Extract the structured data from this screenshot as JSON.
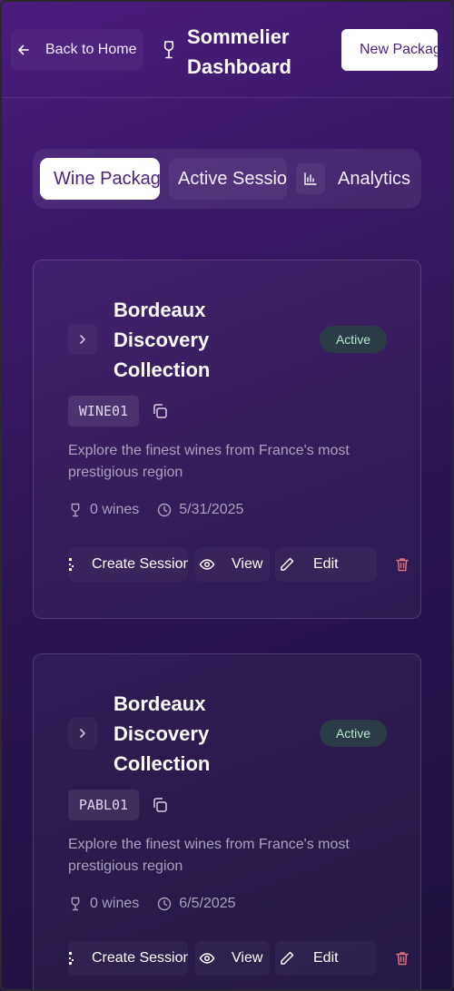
{
  "header": {
    "back_label": "Back to Home",
    "title": "Sommelier Dashboard",
    "new_package_label": "New Package"
  },
  "tabs": [
    {
      "label": "Wine Packages",
      "selected": true
    },
    {
      "label": "Active Sessions",
      "selected": false
    },
    {
      "label": "Analytics",
      "selected": false
    }
  ],
  "packages": [
    {
      "title": "Bordeaux Discovery Collection",
      "status": "Active",
      "code": "WINE01",
      "description": "Explore the finest wines from France's most prestigious region",
      "wines": "0 wines",
      "date": "5/31/2025"
    },
    {
      "title": "Bordeaux Discovery Collection",
      "status": "Active",
      "code": "PABL01",
      "description": "Explore the finest wines from France's most prestigious region",
      "wines": "0 wines",
      "date": "6/5/2025"
    }
  ],
  "actions": {
    "create_session": "Create Session",
    "view": "View",
    "edit": "Edit"
  },
  "colors": {
    "accent": "#4b2480",
    "badge_bg": "#2b3c46",
    "badge_text": "#b7e4cf",
    "delete": "#e0707a"
  }
}
